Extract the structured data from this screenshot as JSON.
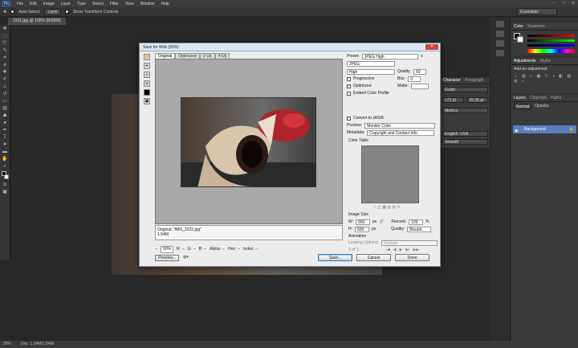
{
  "app": {
    "logo": "Ps",
    "menu": [
      "File",
      "Edit",
      "Image",
      "Layer",
      "Type",
      "Select",
      "Filter",
      "View",
      "Window",
      "Help"
    ]
  },
  "options": {
    "auto_select": "Auto-Select:",
    "layer_dropdown": "Layer",
    "show_transform": "Show Transform Controls",
    "workspace": "Essentials"
  },
  "document": {
    "tab": "2231.jpg @ 100% (RGB/8)"
  },
  "status": {
    "zoom": "99%",
    "doc": "Doc: 1.54M/1.54M"
  },
  "panels": {
    "color_tabs": [
      "Color",
      "Swatches"
    ],
    "adjust_tabs": [
      "Adjustments",
      "Styles"
    ],
    "adjust_label": "Add an adjustment",
    "layers_tabs": [
      "Layers",
      "Channels",
      "Paths"
    ],
    "blend": "Normal",
    "opacity": "Opacity:",
    "layer_name": "Background",
    "char_tabs": [
      "Character",
      "Paragraph"
    ],
    "char_font": "Gulim",
    "char_size": "173 pt",
    "char_leading": "25.55 pt",
    "char_metrics": "Metrics",
    "char_lang": "English: USA",
    "char_aa": "Smooth"
  },
  "dialog": {
    "title": "Save for Web (50%)",
    "view_tabs": [
      "Original",
      "Optimized",
      "2-Up",
      "4-Up"
    ],
    "info_line1": "Original: \"IMG_2231.jpg\"",
    "info_line2": "1.54M",
    "zoom": "50%",
    "r": "R: --",
    "g": "G: --",
    "b": "B: --",
    "alpha": "Alpha: --",
    "hex": "Hex: --",
    "index": "Index: --",
    "preset_label": "Preset:",
    "preset_value": "JPEG High",
    "format": "JPEG",
    "quality_level": "High",
    "quality_label": "Quality:",
    "quality_value": "60",
    "progressive": "Progressive",
    "blur_label": "Blur:",
    "blur_value": "0",
    "optimized": "Optimized",
    "matte_label": "Matte:",
    "embed_profile": "Embed Color Profile",
    "convert_srgb": "Convert to sRGB",
    "preview_label": "Preview:",
    "preview_value": "Monitor Color",
    "metadata_label": "Metadata:",
    "metadata_value": "Copyright and Contact Info",
    "color_table": "Color Table",
    "image_size": "Image Size",
    "w_label": "W:",
    "w_value": "900",
    "h_label": "H:",
    "h_value": "600",
    "px": "px",
    "percent_label": "Percent:",
    "percent_value": "100",
    "pct": "%",
    "quality2_label": "Quality:",
    "quality2_value": "Bicubic",
    "animation": "Animation",
    "looping_label": "Looping Options:",
    "looping_value": "Forever",
    "frame": "1 of 1",
    "preview_btn": "Preview...",
    "save_btn": "Save...",
    "cancel_btn": "Cancel",
    "done_btn": "Done"
  },
  "colors": {
    "accent": "#5a7ec0",
    "dialog_bg": "#ececec"
  }
}
